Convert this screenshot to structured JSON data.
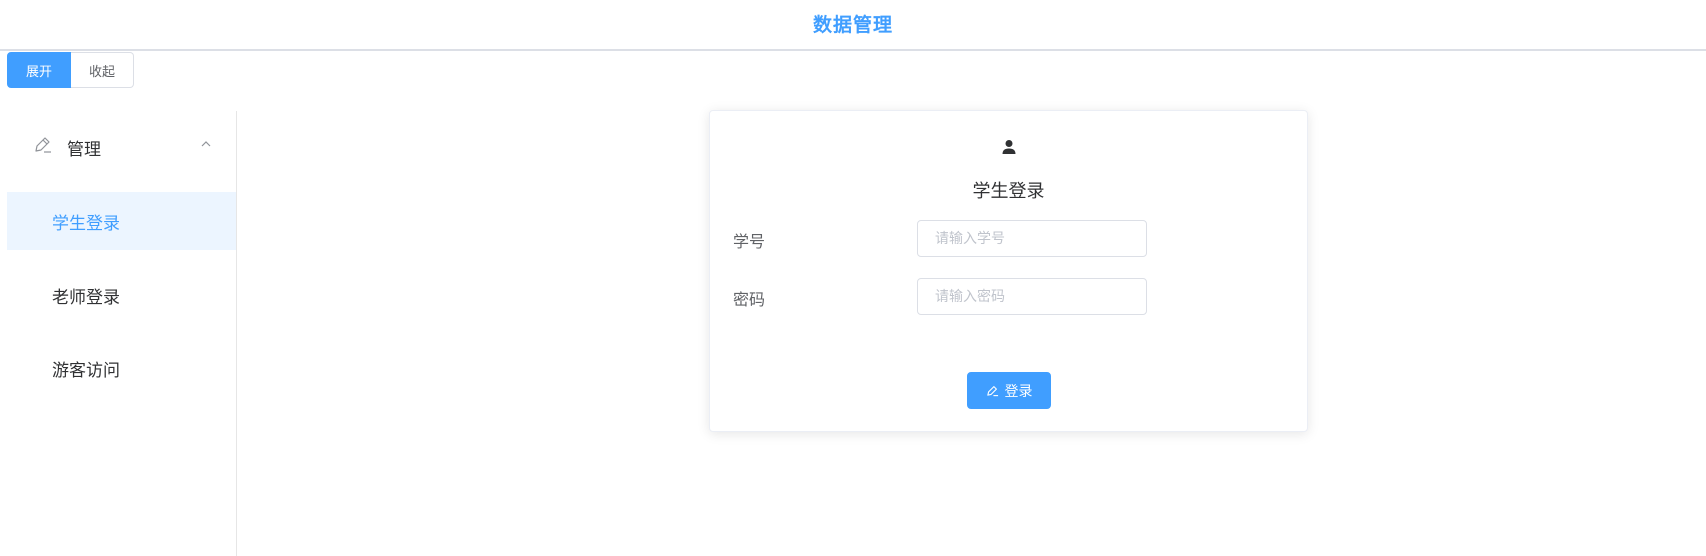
{
  "header": {
    "title": "数据管理"
  },
  "toggle": {
    "expand_label": "展开",
    "collapse_label": "收起"
  },
  "sidebar": {
    "submenu": {
      "icon": "edit-icon",
      "label": "管理",
      "arrow": "chevron-up-icon"
    },
    "items": [
      {
        "label": "学生登录",
        "active": true
      },
      {
        "label": "老师登录",
        "active": false
      },
      {
        "label": "游客访问",
        "active": false
      }
    ]
  },
  "login": {
    "icon": "user-icon",
    "title": "学生登录",
    "fields": [
      {
        "label": "学号",
        "placeholder": "请输入学号",
        "value": ""
      },
      {
        "label": "密码",
        "placeholder": "请输入密码",
        "value": ""
      }
    ],
    "submit_label": "登录",
    "submit_icon": "edit-icon"
  },
  "colors": {
    "accent": "#409eff",
    "active_menu_bg": "#ecf5ff",
    "text": "#303133",
    "border": "#dcdfe6",
    "placeholder": "#c0c4cc"
  }
}
